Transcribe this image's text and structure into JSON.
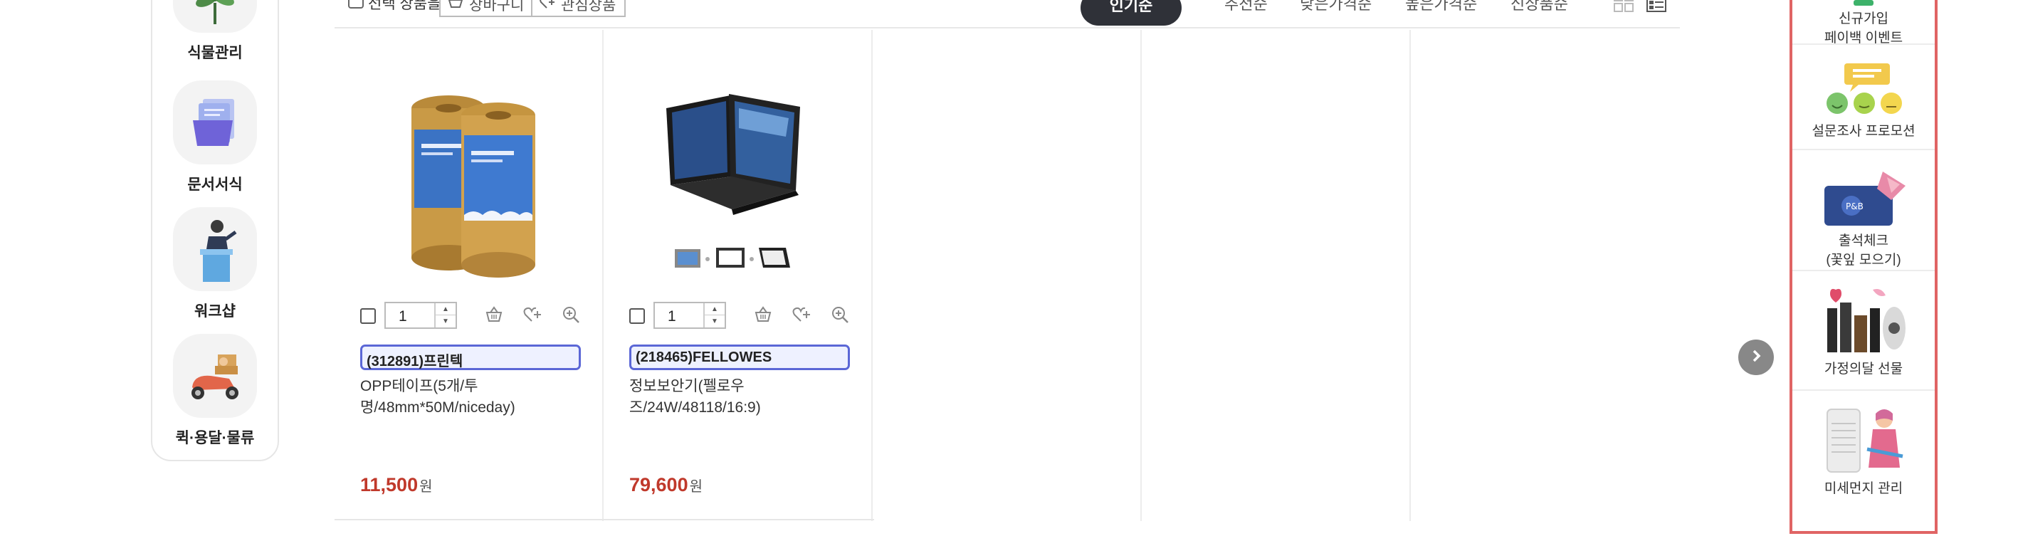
{
  "categories": [
    {
      "label": "식물관리",
      "icon": "plant-icon"
    },
    {
      "label": "문서서식",
      "icon": "document-forms-icon"
    },
    {
      "label": "워크샵",
      "icon": "workshop-presenter-icon"
    },
    {
      "label": "퀵·용달·물류",
      "icon": "delivery-scooter-icon"
    }
  ],
  "toolbar": {
    "select_label": "선택 상품을",
    "cart_button": "장바구니",
    "wishlist_button": "관심상품",
    "sort_options": [
      "인기순",
      "추천순",
      "낮은가격순",
      "높은가격순",
      "신상품순"
    ],
    "active_sort": "인기순"
  },
  "products": [
    {
      "code": "(312891)프린텍",
      "name": "OPP테이프(5개/투명/48mm*50M/niceday)",
      "price": "11,500",
      "currency": "원",
      "quantity": "1",
      "image": "packing-tape-image"
    },
    {
      "code": "(218465)FELLOWES",
      "name": "정보보안기(펠로우즈/24W/48118/16:9)",
      "price": "79,600",
      "currency": "원",
      "quantity": "1",
      "image": "privacy-filter-laptop-image"
    }
  ],
  "promos": [
    {
      "line1": "신규가입",
      "line2": "페이백 이벤트"
    },
    {
      "line1": "설문조사 프로모션",
      "line2": ""
    },
    {
      "line1": "출석체크",
      "line2": "(꽃잎 모으기)"
    },
    {
      "line1": "가정의달 선물",
      "line2": ""
    },
    {
      "line1": "미세먼지 관리",
      "line2": ""
    }
  ],
  "colors": {
    "accent_blue": "#5b67d6",
    "price_red": "#c0392b",
    "active_sort_bg": "#2f3138",
    "promo_border": "#e06464"
  }
}
